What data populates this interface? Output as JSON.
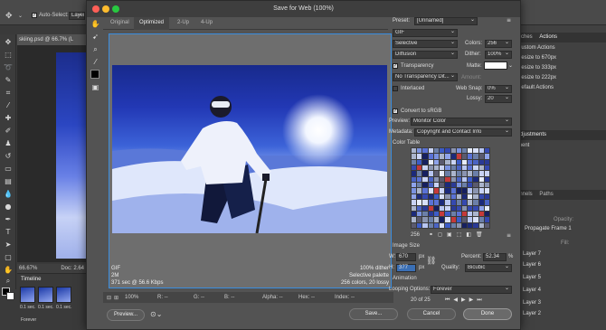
{
  "app": {
    "auto_select_label": "Auto-Select:",
    "auto_select_value": "Layer"
  },
  "document": {
    "tab_title": "skiing.psd @ 66.7% (L",
    "zoom": "66.67%",
    "doc_size": "Doc: 2.64"
  },
  "timeline": {
    "title": "Timeline",
    "frames": [
      "0.1 sec.",
      "0.1 sec.",
      "0.1 sec."
    ],
    "loop": "Forever"
  },
  "right_panels": {
    "tabs_top": [
      "atches",
      "Actions"
    ],
    "actions": [
      "Custom Actions",
      "Resize to 670px",
      "Resize to 333px",
      "Resize to 222px",
      "Default Actions"
    ],
    "adjustments_title": "Adjustments",
    "add_adjustment": "ment",
    "layer_tabs": [
      "annels",
      "Paths"
    ],
    "opacity_label": "Opacity:",
    "fill_label": "Fill:",
    "propagate": "Propagate Frame 1",
    "layers": [
      "Layer 7",
      "Layer 6",
      "Layer 5",
      "Layer 4",
      "Layer 3",
      "Layer 2"
    ]
  },
  "dialog": {
    "title": "Save for Web (100%)",
    "tabs": [
      "Original",
      "Optimized",
      "2-Up",
      "4-Up"
    ],
    "preview_info": {
      "format": "GIF",
      "size": "2M",
      "time": "371 sec @ 56.6 Kbps",
      "dither": "100% dither",
      "palette": "Selective palette",
      "colors": "256 colors, 20 lossy"
    },
    "zoom": "100%",
    "readouts": {
      "r": "R: --",
      "g": "G: --",
      "b": "B: --",
      "alpha": "Alpha: --",
      "hex": "Hex: --",
      "index": "Index: --"
    },
    "buttons": {
      "preview": "Preview...",
      "save": "Save...",
      "cancel": "Cancel",
      "done": "Done"
    },
    "settings": {
      "preset_label": "Preset:",
      "preset_value": "[Unnamed]",
      "format_value": "GIF",
      "reduction": "Selective",
      "colors_label": "Colors:",
      "colors_value": "256",
      "dither_algo": "Diffusion",
      "dither_label": "Dither:",
      "dither_value": "100%",
      "transparency_label": "Transparency",
      "matte_label": "Matte:",
      "trans_dither": "No Transparency Dit...",
      "amount_label": "Amount:",
      "interlaced_label": "Interlaced",
      "websnap_label": "Web Snap:",
      "websnap_value": "0%",
      "lossy_label": "Lossy:",
      "lossy_value": "20",
      "srgb_label": "Convert to sRGB",
      "preview_label": "Preview:",
      "preview_value": "Monitor Color",
      "metadata_label": "Metadata:",
      "metadata_value": "Copyright and Contact Info",
      "color_table_label": "Color Table",
      "color_count": "256",
      "image_size_label": "Image Size",
      "w_label": "W:",
      "w_value": "670",
      "h_label": "H:",
      "h_value": "377",
      "px": "px",
      "percent_label": "Percent:",
      "percent_value": "52.34",
      "percent_unit": "%",
      "quality_label": "Quality:",
      "quality_value": "Bicubic",
      "animation_label": "Animation",
      "looping_label": "Looping Options:",
      "looping_value": "Forever",
      "frame_counter": "20 of 25"
    }
  },
  "colors": {
    "accent": "#3a8dde",
    "dialog_bg": "#535353",
    "panel_bg": "#414141"
  }
}
